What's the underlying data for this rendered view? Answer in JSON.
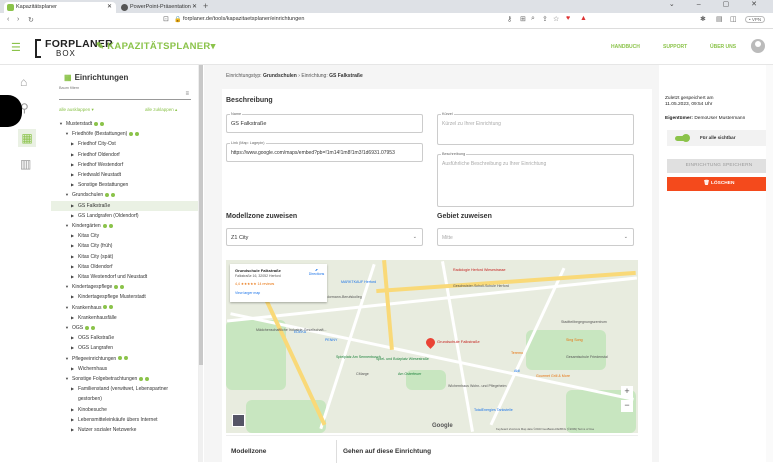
{
  "browser": {
    "tabs": [
      {
        "label": "Kapazitätsplaner",
        "color": "#8bc34a"
      },
      {
        "label": "PowerPoint-Präsentation",
        "color": "#555"
      }
    ],
    "url": "forplaner.de/tools/kapazitaetsplaner/einrichtungen",
    "vpn": "• VPN"
  },
  "header": {
    "logo_top": "FORPLANER",
    "logo_bottom": "BOX",
    "app_name": "KAPAZITÄTSPLANER",
    "app_caret": "▾",
    "nav": [
      "HANDBUCH",
      "SUPPORT",
      "ÜBER UNS"
    ]
  },
  "tree": {
    "title": "Einrichtungen",
    "search_label": "Baum filtern",
    "expand_all": "alle ausklappen ▾",
    "collapse_all": "alle zuklappen ▴",
    "items": [
      {
        "label": "Musterstadt",
        "level": 0,
        "dot": true,
        "arrow": "▼"
      },
      {
        "label": "Friedhöfe (Bestattungen)",
        "level": 1,
        "dot": true,
        "arrow": "▼"
      },
      {
        "label": "Friedhof City-Ost",
        "level": 2,
        "dot": false,
        "arrow": "▶"
      },
      {
        "label": "Friedhof Oldendorf",
        "level": 2,
        "dot": false,
        "arrow": "▶"
      },
      {
        "label": "Friedhof Westendorf",
        "level": 2,
        "dot": false,
        "arrow": "▶"
      },
      {
        "label": "Friedwald Neustadt",
        "level": 2,
        "dot": false,
        "arrow": "▶"
      },
      {
        "label": "Sonstige Bestattungen",
        "level": 2,
        "dot": false,
        "arrow": "▶"
      },
      {
        "label": "Grundschulen",
        "level": 1,
        "dot": true,
        "arrow": "▼"
      },
      {
        "label": "GS Falkstraße",
        "level": 2,
        "dot": false,
        "arrow": "▶",
        "selected": true
      },
      {
        "label": "GS Landgrafen (Oldendorf)",
        "level": 2,
        "dot": false,
        "arrow": "▶"
      },
      {
        "label": "Kindergärten",
        "level": 1,
        "dot": true,
        "arrow": "▼"
      },
      {
        "label": "Kitas City",
        "level": 2,
        "dot": false,
        "arrow": "▶"
      },
      {
        "label": "Kitas City (früh)",
        "level": 2,
        "dot": false,
        "arrow": "▶"
      },
      {
        "label": "Kitas City (spät)",
        "level": 2,
        "dot": false,
        "arrow": "▶"
      },
      {
        "label": "Kitas Oldendorf",
        "level": 2,
        "dot": false,
        "arrow": "▶"
      },
      {
        "label": "Kitas Westendorf und Neustadt",
        "level": 2,
        "dot": false,
        "arrow": "▶"
      },
      {
        "label": "Kindertagespflege",
        "level": 1,
        "dot": true,
        "arrow": "▼"
      },
      {
        "label": "Kindertagespflege Musterstadt",
        "level": 2,
        "dot": false,
        "arrow": "▶"
      },
      {
        "label": "Krankenhaus",
        "level": 1,
        "dot": true,
        "arrow": "▼"
      },
      {
        "label": "Krankenhausfälle",
        "level": 2,
        "dot": false,
        "arrow": "▶"
      },
      {
        "label": "OGS",
        "level": 1,
        "dot": true,
        "arrow": "▼"
      },
      {
        "label": "OGS Falkstraße",
        "level": 2,
        "dot": false,
        "arrow": "▶"
      },
      {
        "label": "OGS Langrafen",
        "level": 2,
        "dot": false,
        "arrow": "▶"
      },
      {
        "label": "Pflegeeinrichtungen",
        "level": 1,
        "dot": true,
        "arrow": "▼"
      },
      {
        "label": "Wichernhaus",
        "level": 2,
        "dot": false,
        "arrow": "▶"
      },
      {
        "label": "Sonstige Folgebetrachtungen",
        "level": 1,
        "dot": true,
        "arrow": "▼"
      },
      {
        "label": "Familienstand (verwitwet, Lebenspartner",
        "level": 2,
        "dot": false,
        "arrow": "▶"
      },
      {
        "label": "gestorben)",
        "level": 2,
        "dot": false,
        "arrow": "",
        "cont": true
      },
      {
        "label": "Kinobesuche",
        "level": 2,
        "dot": false,
        "arrow": "▶"
      },
      {
        "label": "Lebensmitteleinkäufe übers Internet",
        "level": 2,
        "dot": false,
        "arrow": "▶"
      },
      {
        "label": "Nutzer sozialer Netzwerke",
        "level": 2,
        "dot": false,
        "arrow": "▶"
      }
    ]
  },
  "breadcrumb": {
    "prefix": "Einrichtungstyp:",
    "type": "Grundschulen",
    "sep": "›",
    "prefix2": "Einrichtung:",
    "name": "GS Falkstraße"
  },
  "form": {
    "section_desc": "Beschreibung",
    "name_label": "Name",
    "name_value": "GS Falkstraße",
    "kurz_label": "Kürzel",
    "kurz_placeholder": "Kürzel zu Ihrer Einrichtung",
    "link_label": "Link (Map: Lagepin)",
    "link_value": "https://www.google.com/maps/embed?pb=!1m14!1m8!1m3!1d6931.07953",
    "besch_label": "Beschreibung",
    "besch_placeholder": "Ausführliche Beschreibung zu Ihrer Einrichtung",
    "section_model": "Modellzone zuweisen",
    "model_value": "Z1 City",
    "section_gebiet": "Gebiet zuweisen",
    "gebiet_value": "Mitte"
  },
  "map": {
    "info_title": "Grundschule Falkstraße",
    "info_addr": "Falkstraße 16, 32052 Herford",
    "info_rating": "4,4 ★★★★★  14 reviews",
    "info_link": "View larger map",
    "info_dir": "Directions",
    "labels": [
      "MARKTKAUF Herford",
      "Radiologie Herford Wiesestrasse",
      "Geschwister-Scholl-Schule Herford",
      "Grundschule Falkstraße",
      "Wilhelm-Normann-Berufskolleg",
      "Mädchenschaftliche Industrie-Gesellschaft...",
      "PENNY",
      "Spielplatz Am Sennenbusch",
      "Spiel- und Bolzplatz Wiesestraße",
      "Am Osterfeuer",
      "Wichernhaus Wohn- und Pflegeheim",
      "Teremo",
      "Gesamtschule Friedenstal",
      "Aldi",
      "Gourmet Grill & More",
      "TotalEnergies Tankstelle",
      "Stadtteilbegegnungszentrum",
      "Sing Song",
      "EDEKA",
      "CMarge",
      "Google"
    ],
    "footer": "Keyboard shortcuts  Map data ©2023 GeoBasis-DE/BKG (©2009)  Terms of Use",
    "zoom_in": "+",
    "zoom_out": "−"
  },
  "table": {
    "col1": "Modellzone",
    "col2": "Gehen auf diese Einrichtung"
  },
  "right": {
    "saved_l1": "Zuletzt gespeichert am",
    "saved_l2": "11.05.2023, 09:54 Uhr",
    "owner_label": "Eigentümer:",
    "owner_value": "DemoUser Mustermann",
    "toggle_label": "Für alle sichtbar",
    "save_btn": "EINRICHTUNG SPEICHERN",
    "del_btn": "🗑 LÖSCHEN"
  }
}
